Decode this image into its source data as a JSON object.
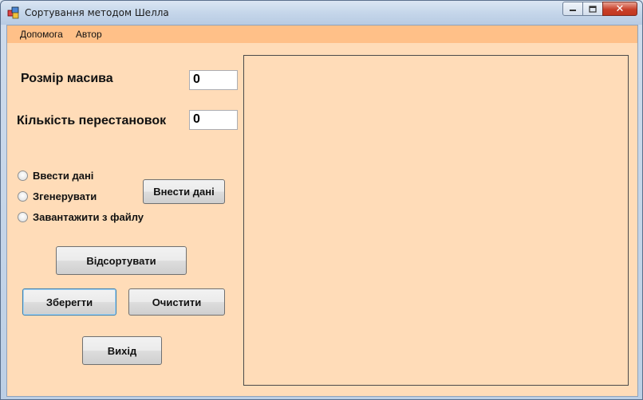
{
  "window": {
    "title": "Сортування методом Шелла"
  },
  "menu": {
    "items": [
      "Допомога",
      "Автор"
    ]
  },
  "form": {
    "array_size_label": "Розмір масива",
    "array_size_value": "0",
    "permutations_label": "Кількість перестановок",
    "permutations_value": "0"
  },
  "radios": {
    "enter": "Ввести дані",
    "generate": "Згенерувати",
    "load": "Завантажити з файлу"
  },
  "buttons": {
    "input_data": "Внести дані",
    "sort": "Відсортувати",
    "save": "Зберегти",
    "clear": "Очистити",
    "exit": "Вихід"
  },
  "colors": {
    "client_bg": "#ffdcb8",
    "menu_bg": "#ffc088"
  },
  "icons": {
    "app": "windows-forms-app-icon",
    "minimize": "minimize-icon",
    "maximize": "maximize-icon",
    "close": "close-icon"
  }
}
